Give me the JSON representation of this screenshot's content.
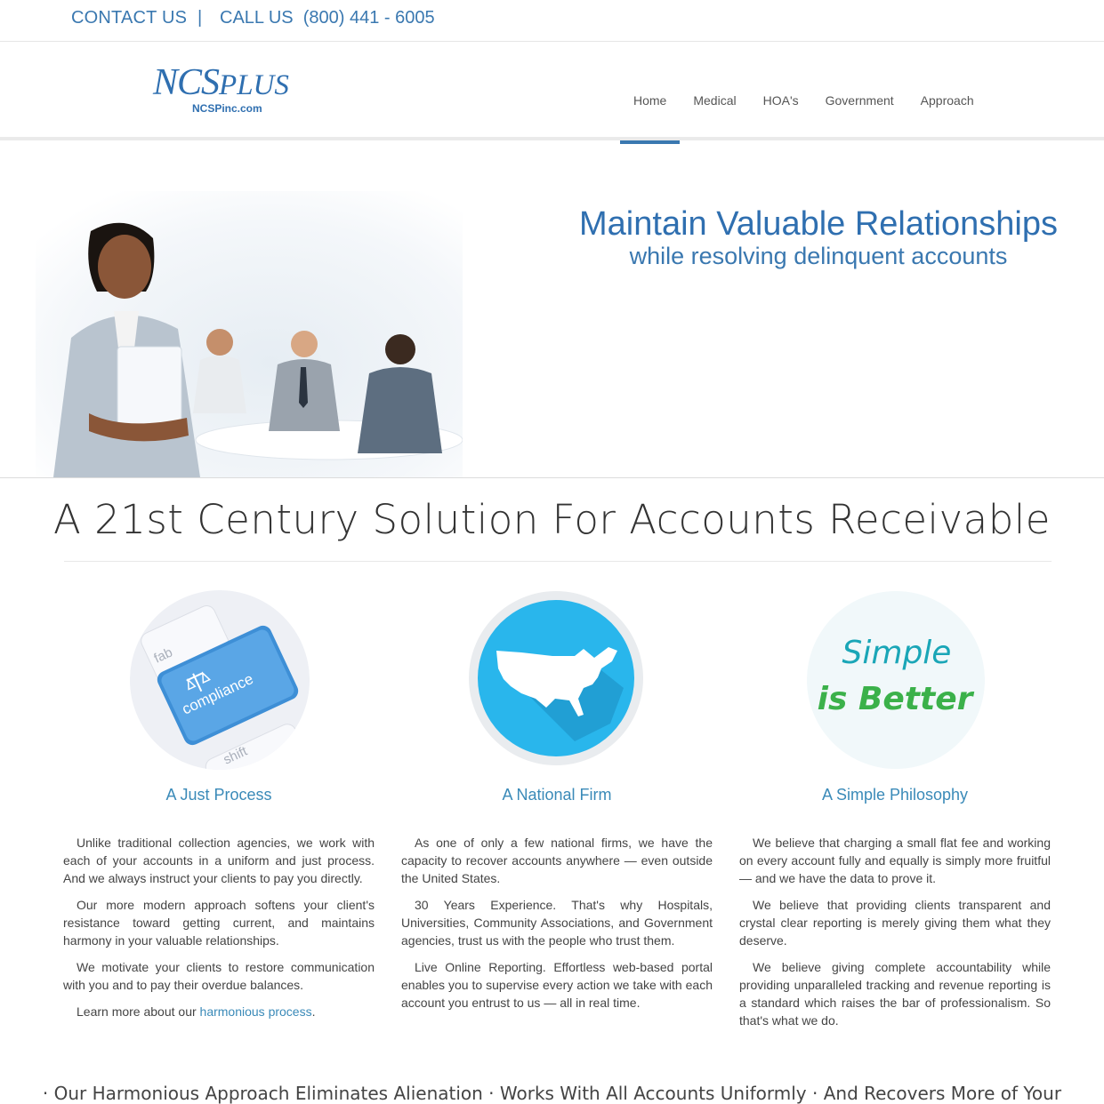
{
  "topbar": {
    "contact_label": "CONTACT US",
    "separator": "|",
    "call_label": "CALL US  (800) 441 - 6005"
  },
  "logo": {
    "brand_main": "NCS",
    "brand_plus": "PLUS",
    "site": "NCSPinc.com"
  },
  "nav": {
    "items": [
      {
        "label": "Home",
        "active": true
      },
      {
        "label": "Medical"
      },
      {
        "label": "HOA's"
      },
      {
        "label": "Government"
      },
      {
        "label": "Approach"
      }
    ]
  },
  "hero": {
    "title": "Maintain Valuable Relationships",
    "subtitle": "while resolving delinquent accounts"
  },
  "section": {
    "title": "A 21st Century Solution For Accounts Receivable"
  },
  "columns": [
    {
      "heading": "A Just Process",
      "image_text": "compliance",
      "image_key_1": "fab",
      "image_key_2": "shift",
      "paragraphs": [
        "Unlike traditional collection agencies, we work with each of your accounts in a uniform and just process. And we always instruct your clients to pay you directly.",
        "Our more modern approach softens your client's resistance toward getting current, and maintains harmony in your valuable relationships.",
        "We motivate your clients to restore communication with you and to pay their overdue balances."
      ],
      "learn_more_prefix": "Learn more about our ",
      "learn_more_link": "harmonious process",
      "learn_more_suffix": "."
    },
    {
      "heading": "A National Firm",
      "paragraphs": [
        "As one of only a few national firms, we have the capacity to recover accounts anywhere — even outside the United States.",
        "30 Years Experience. That's why Hospitals, Universities, Community Associations, and Government agencies, trust us with the people who trust them.",
        "Live Online Reporting. Effortless web-based portal enables you to supervise every action we take with each account you entrust to us — all in real time."
      ]
    },
    {
      "heading": "A Simple Philosophy",
      "image_line1": "Simple",
      "image_line2": "is Better",
      "paragraphs": [
        "We believe that charging a small flat fee and working on every account fully and equally is simply more fruitful — and we have the data to prove it.",
        "We believe that providing clients transparent and crystal clear reporting is merely giving them what they deserve.",
        "We believe giving complete accountability while providing unparalleled tracking and revenue reporting is a standard which raises the bar of professionalism. So that's what we do."
      ]
    }
  ],
  "bottom_tagline": "· Our Harmonious Approach Eliminates Alienation · Works With All Accounts Uniformly · And Recovers More of Your",
  "colors": {
    "brand_blue": "#2f6fb0",
    "link_blue": "#3a8ab8",
    "map_blue": "#29b6ec",
    "simple_teal": "#1aa6b7",
    "better_green": "#3bb14a"
  }
}
